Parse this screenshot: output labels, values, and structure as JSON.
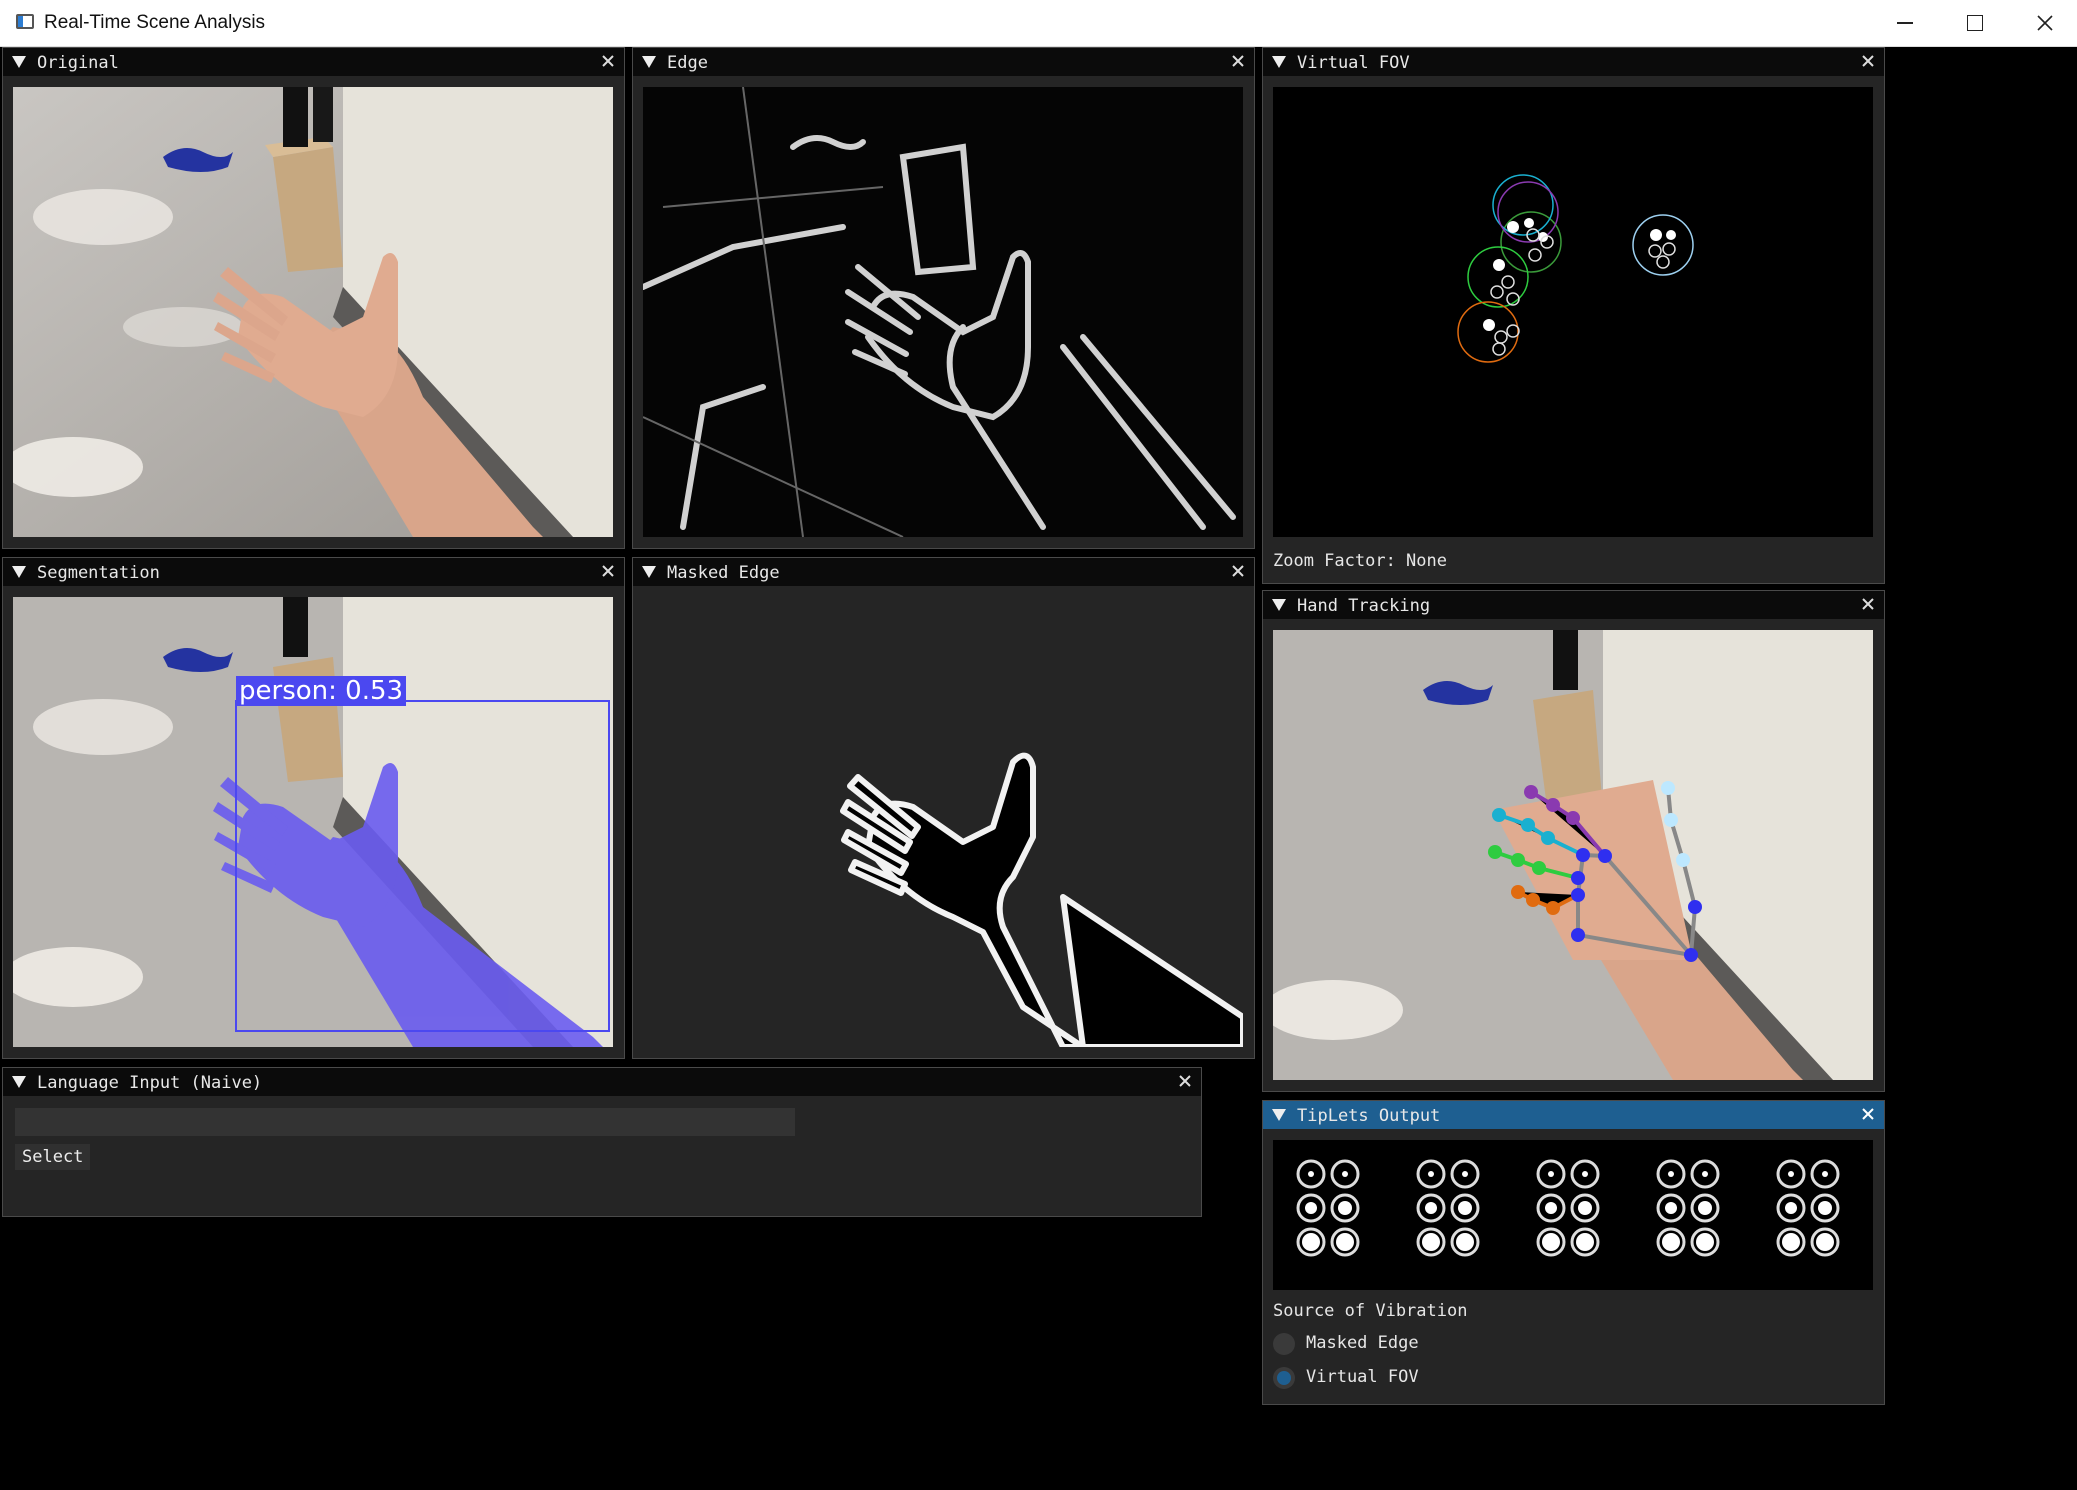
{
  "window": {
    "title": "Real-Time Scene Analysis"
  },
  "panels": {
    "original": {
      "title": "Original"
    },
    "edge": {
      "title": "Edge"
    },
    "virtual_fov": {
      "title": "Virtual FOV",
      "zoom_label": "Zoom Factor: None"
    },
    "segmentation": {
      "title": "Segmentation",
      "detection_label": "person: 0.53"
    },
    "masked_edge": {
      "title": "Masked Edge"
    },
    "hand_tracking": {
      "title": "Hand Tracking"
    },
    "language_input": {
      "title": "Language Input (Naive)",
      "input_value": "",
      "select_label": "Select"
    },
    "tiplets_output": {
      "title": "TipLets Output",
      "source_label": "Source of Vibration",
      "options": [
        {
          "label": "Masked Edge",
          "selected": false
        },
        {
          "label": "Virtual FOV",
          "selected": true
        }
      ]
    }
  },
  "colors": {
    "accent": "#1e5f91",
    "detection_box": "#4b48f0",
    "segmentation_mask": "#6a5cf0"
  },
  "icons": {
    "collapse": "triangle-down-icon",
    "close": "close-icon"
  }
}
